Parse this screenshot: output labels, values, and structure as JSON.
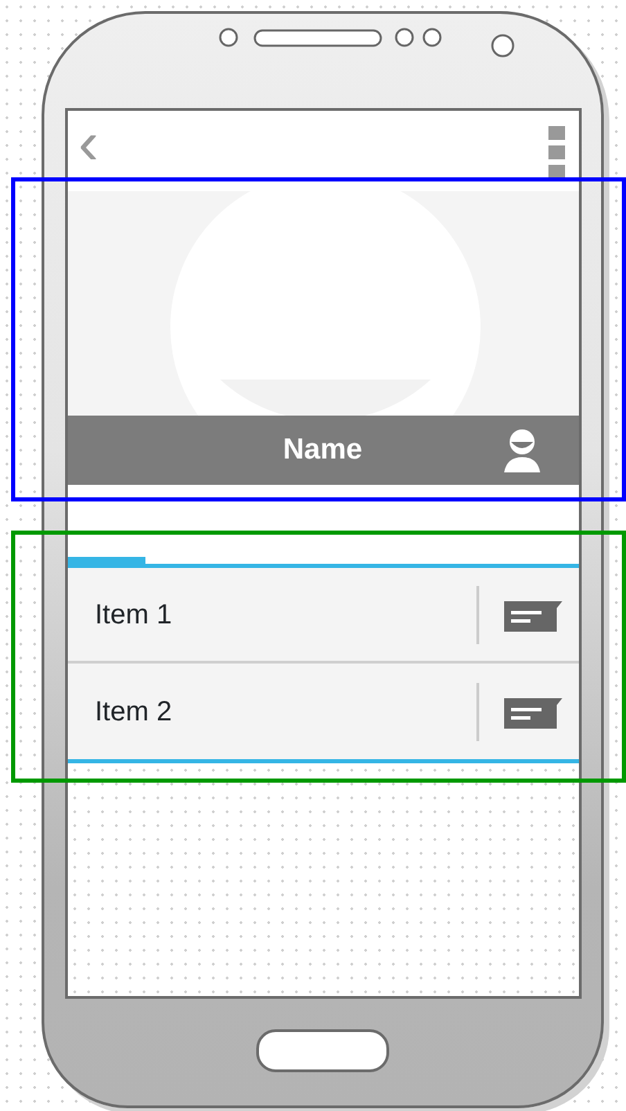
{
  "app_bar": {
    "back_icon": "‹"
  },
  "profile": {
    "name": "Name"
  },
  "tab_strip": {
    "tabs": [
      {
        "selected": true
      }
    ]
  },
  "items": [
    {
      "label": "Item 1"
    },
    {
      "label": "Item 2"
    }
  ],
  "highlights": [
    {
      "color": "#0000ff"
    },
    {
      "color": "#009900"
    }
  ]
}
